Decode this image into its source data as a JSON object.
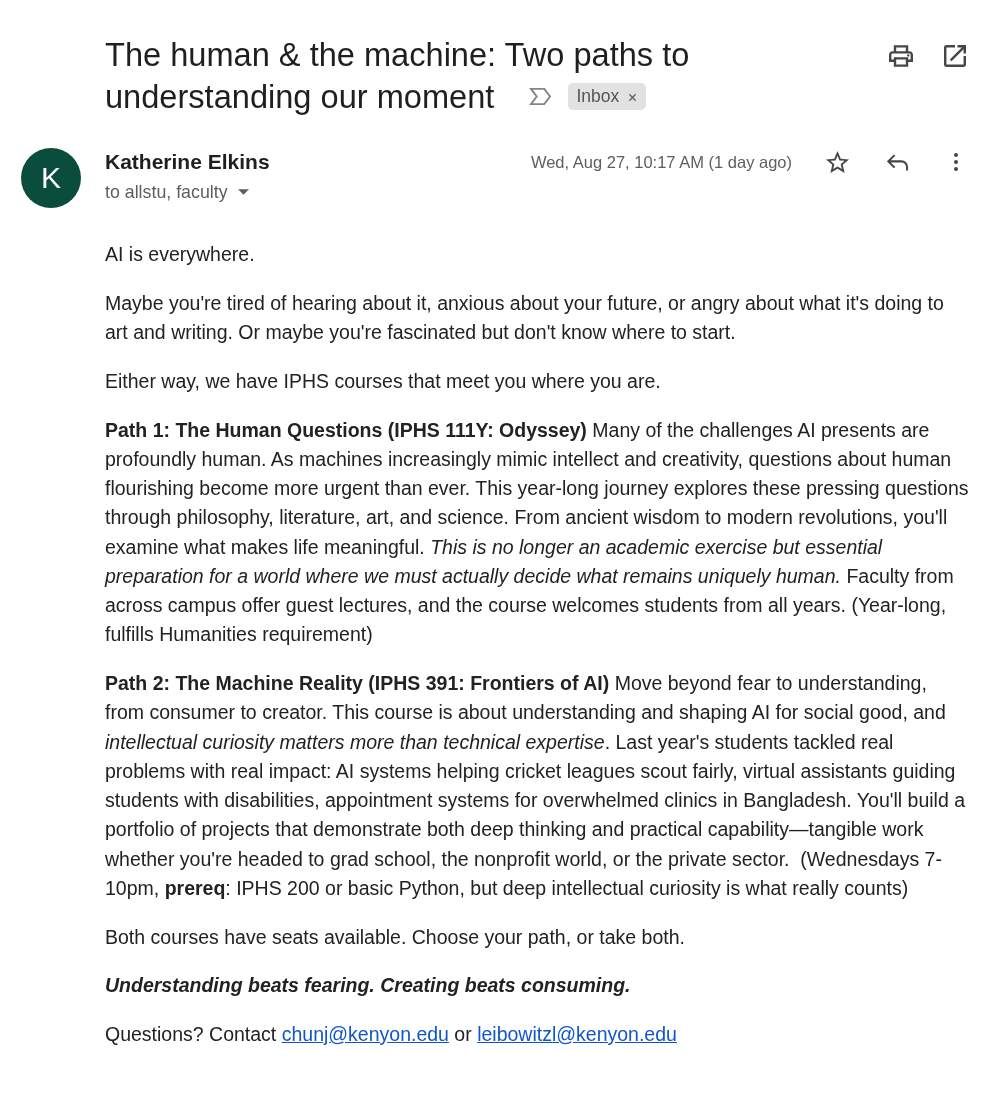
{
  "message": {
    "subject_lines": [
      "The human & the machine: Two paths to",
      "understanding our moment"
    ],
    "important": false,
    "labels": [
      {
        "text": "Inbox"
      }
    ]
  },
  "sender": {
    "initial": "K",
    "name": "Katherine Elkins",
    "recipients": "to allstu, faculty",
    "date": "Wed, Aug 27, 10:17 AM (1 day ago)",
    "starred": false
  },
  "body": [
    {
      "kind": "text",
      "text": "AI is everywhere."
    },
    {
      "kind": "text",
      "text": "Maybe you're tired of hearing about it, anxious about your future, or angry about what it's doing to art and writing. Or maybe you're fascinated but don't know where to start."
    },
    {
      "kind": "text",
      "text": "Either way, we have IPHS courses that meet you where you are."
    },
    {
      "kind": "text",
      "text": "**Path 1: The Human Questions (IPHS 111Y: Odyssey)** Many of the challenges AI presents are profoundly human. As machines increasingly mimic intellect and creativity, questions about human flourishing become more urgent than ever. This year-long journey explores these pressing questions through philosophy, literature, art, and science. From ancient wisdom to modern revolutions, you'll examine what makes life meaningful. *This is no longer an academic exercise but essential preparation for a world where we must actually decide what remains uniquely human.* Faculty from across campus offer guest lectures, and the course welcomes students from all years. (Year-long, fulfills Humanities requirement)"
    },
    {
      "kind": "text",
      "text": "**Path 2: The Machine Reality (IPHS 391: Frontiers of AI)** Move beyond fear to understanding, from consumer to creator. This course is about understanding and shaping AI for social good, and *intellectual curiosity matters more than technical expertise*. Last year's students tackled real problems with real impact: AI systems helping cricket leagues scout fairly, virtual assistants guiding students with disabilities, appointment systems for overwhelmed clinics in Bangladesh. You'll build a portfolio of projects that demonstrate both deep thinking and practical capability—tangible work whether you're headed to grad school, the nonprofit world, or the private sector.  (Wednesdays 7-10pm, **prereq**: IPHS 200 or basic Python, but deep intellectual curiosity is what really counts)"
    },
    {
      "kind": "text",
      "text": "Both courses have seats available. Choose your path, or take both."
    },
    {
      "kind": "motto",
      "text": "Understanding beats fearing. Creating beats consuming."
    },
    {
      "kind": "contact",
      "parts": [
        {
          "kind": "text",
          "text": "Questions? Contact "
        },
        {
          "kind": "link",
          "text": "chunj@kenyon.edu"
        },
        {
          "kind": "text",
          "text": " or "
        },
        {
          "kind": "link",
          "text": "leibowitzl@kenyon.edu"
        }
      ]
    }
  ]
}
